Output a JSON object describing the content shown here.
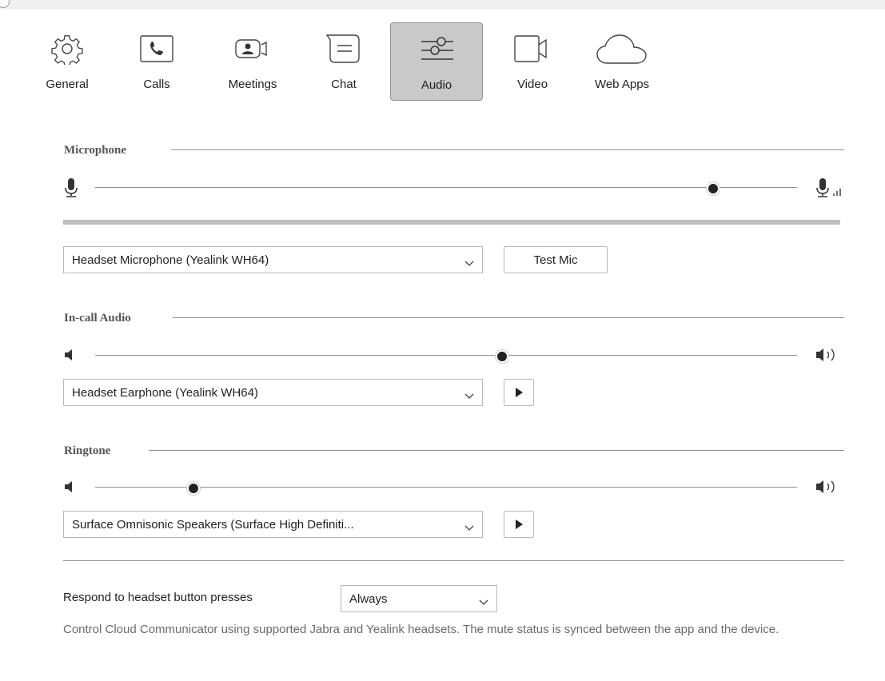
{
  "tabs": [
    {
      "label": "General",
      "icon": "gear-icon"
    },
    {
      "label": "Calls",
      "icon": "phone-icon"
    },
    {
      "label": "Meetings",
      "icon": "meeting-camera-icon"
    },
    {
      "label": "Chat",
      "icon": "chat-icon"
    },
    {
      "label": "Audio",
      "icon": "audio-sliders-icon",
      "active": true
    },
    {
      "label": "Video",
      "icon": "video-camera-icon"
    },
    {
      "label": "Web Apps",
      "icon": "cloud-icon"
    }
  ],
  "microphone": {
    "title": "Microphone",
    "volume_fraction": 0.88,
    "device": "Headset Microphone (Yealink WH64)",
    "test_button": "Test Mic"
  },
  "incall": {
    "title": "In-call Audio",
    "volume_fraction": 0.58,
    "device": "Headset Earphone (Yealink WH64)"
  },
  "ringtone": {
    "title": "Ringtone",
    "volume_fraction": 0.14,
    "device": "Surface Omnisonic Speakers (Surface High Definiti..."
  },
  "headset": {
    "label": "Respond to headset button presses",
    "value": "Always",
    "help": "Control Cloud Communicator using supported Jabra and Yealink headsets. The mute status is synced between the app and the device."
  },
  "colors": {
    "active_tab": "#c9c9c9",
    "thumb": "#222222",
    "level_bar": "#bdbdbd"
  }
}
